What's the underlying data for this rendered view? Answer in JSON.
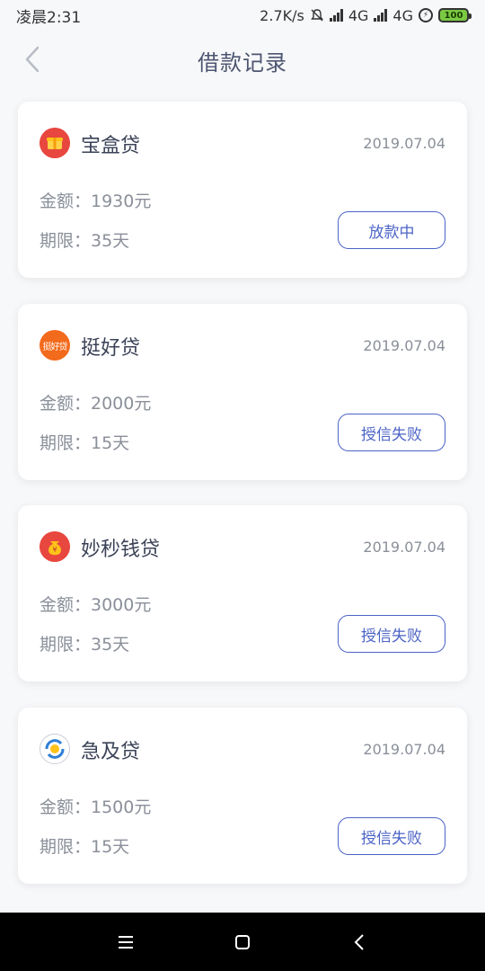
{
  "status_bar": {
    "time": "凌晨2:31",
    "speed": "2.7K/s",
    "network1": "4G",
    "network2": "4G",
    "battery": "100"
  },
  "header": {
    "title": "借款记录"
  },
  "records": [
    {
      "name": "宝盒贷",
      "date": "2019.07.04",
      "amount": "金额：1930元",
      "term": "期限：35天",
      "status": "放款中",
      "logo_color": "#e8473f",
      "logo_icon": "gift-box-icon"
    },
    {
      "name": "挺好贷",
      "date": "2019.07.04",
      "amount": "金额：2000元",
      "term": "期限：15天",
      "status": "授信失败",
      "logo_color": "#f26a1b",
      "logo_icon": "tinghaodai-logo",
      "logo_text": "挺好贷"
    },
    {
      "name": "妙秒钱贷",
      "date": "2019.07.04",
      "amount": "金额：3000元",
      "term": "期限：35天",
      "status": "授信失败",
      "logo_color": "#e8473f",
      "logo_icon": "money-bag-icon"
    },
    {
      "name": "急及贷",
      "date": "2019.07.04",
      "amount": "金额：1500元",
      "term": "期限：15天",
      "status": "授信失败",
      "logo_color": "#2f7fd6",
      "logo_icon": "coin-cycle-icon"
    }
  ],
  "colors": {
    "accent": "#4b63c6",
    "title": "#4d5670",
    "muted": "#8a8f99"
  }
}
